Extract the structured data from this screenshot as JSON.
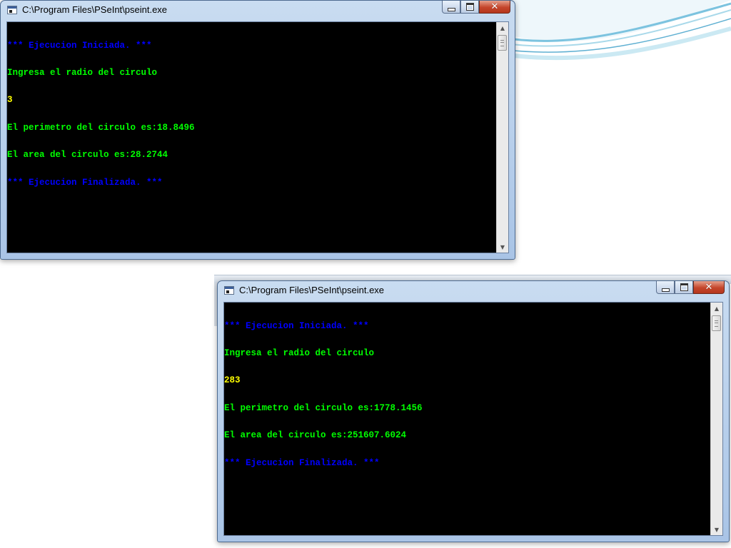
{
  "windows": [
    {
      "title": "C:\\Program Files\\PSeInt\\pseint.exe",
      "controls": {
        "minimize": "minimize",
        "maximize": "maximize",
        "close": "✕"
      },
      "lines": [
        {
          "text": "*** Ejecucion Iniciada. ***",
          "color": "#0000ff"
        },
        {
          "text": "Ingresa el radio del circulo",
          "color": "#00ff00"
        },
        {
          "text": "3",
          "color": "#ffff00"
        },
        {
          "text": "El perimetro del circulo es:18.8496",
          "color": "#00ff00"
        },
        {
          "text": "El area del circulo es:28.2744",
          "color": "#00ff00"
        },
        {
          "text": "*** Ejecucion Finalizada. ***",
          "color": "#0000ff"
        }
      ]
    },
    {
      "title": "C:\\Program Files\\PSeInt\\pseint.exe",
      "controls": {
        "minimize": "minimize",
        "maximize": "maximize",
        "close": "✕"
      },
      "lines": [
        {
          "text": "*** Ejecucion Iniciada. ***",
          "color": "#0000ff"
        },
        {
          "text": "Ingresa el radio del circulo",
          "color": "#00ff00"
        },
        {
          "text": "283",
          "color": "#ffff00"
        },
        {
          "text": "El perimetro del circulo es:1778.1456",
          "color": "#00ff00"
        },
        {
          "text": "El area del circulo es:251607.6024",
          "color": "#00ff00"
        },
        {
          "text": "*** Ejecucion Finalizada. ***",
          "color": "#0000ff"
        }
      ]
    }
  ],
  "icons": {
    "window_icon": "console-window-icon",
    "scroll_up": "▲",
    "scroll_down": "▼"
  },
  "colors": {
    "console_bg": "#000000",
    "prompt_text": "#00ff00",
    "user_input": "#ffff00",
    "system_message": "#0000ff"
  }
}
